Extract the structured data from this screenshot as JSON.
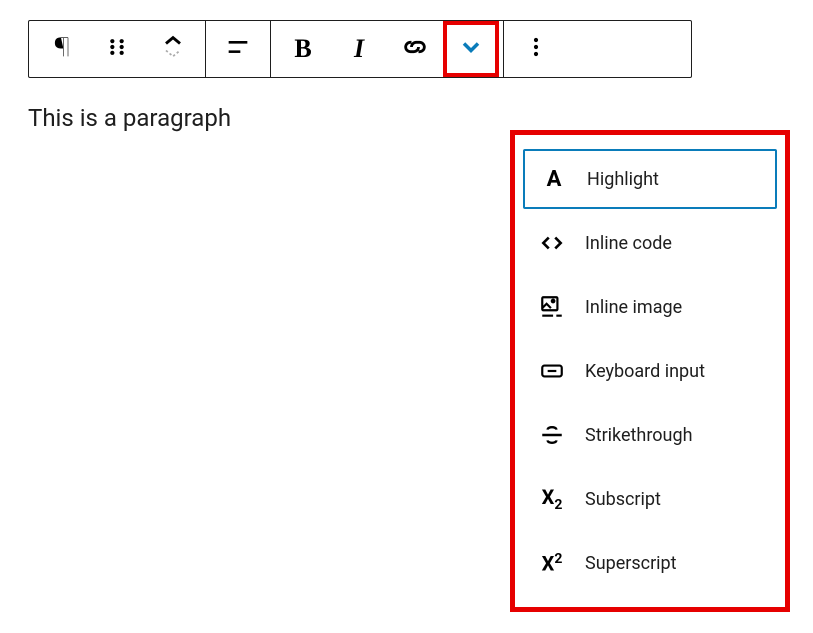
{
  "content": {
    "paragraph": "This is a paragraph"
  },
  "dropdown": {
    "items": [
      {
        "label": "Highlight",
        "icon": "highlight"
      },
      {
        "label": "Inline code",
        "icon": "inline-code"
      },
      {
        "label": "Inline image",
        "icon": "inline-image"
      },
      {
        "label": "Keyboard input",
        "icon": "keyboard"
      },
      {
        "label": "Strikethrough",
        "icon": "strikethrough"
      },
      {
        "label": "Subscript",
        "icon": "subscript"
      },
      {
        "label": "Superscript",
        "icon": "superscript"
      }
    ],
    "selected_index": 0
  },
  "colors": {
    "highlight": "#e60000",
    "selected": "#0a7cba"
  }
}
